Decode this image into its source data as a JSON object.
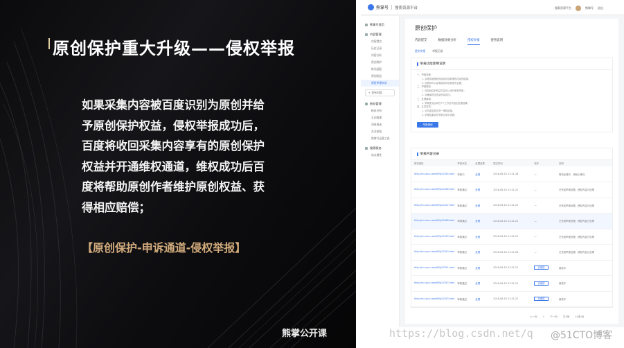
{
  "slide": {
    "title": "原创保护重大升级——侵权举报",
    "body": "如果采集内容被百度识别为原创并给予原创保护权益，侵权举报成功后，百度将收回采集内容享有的原创保护权益并开通维权通道，维权成功后百度将帮助原创作者维护原创权益、获得相应赔偿；",
    "highlight": "【原创保护-申诉通道-侵权举报】",
    "logo": "熊掌公开课"
  },
  "screenshot": {
    "brand": "熊掌号",
    "brand_sub": "搜索资源平台",
    "top_links": [
      "搜索资源平台",
      "熊掌号",
      "退出"
    ],
    "sidebar": [
      {
        "head": "熊掌号首页",
        "items": []
      },
      {
        "head": "内容管理",
        "items": [
          "内容提交",
          "历史记录",
          "内容分析",
          "原创保护",
          "移动适配",
          "原创权益",
          "侵权举报申诉"
        ]
      },
      {
        "head": "",
        "button": "+ 发布内容",
        "items": []
      },
      {
        "head": "粉丝管理",
        "items": [
          "粉丝分析",
          "互动管理",
          "消息推送",
          "关注按钮",
          "熊掌号运营工具"
        ]
      },
      {
        "head": "搜索服务",
        "items": [
          "站点属性"
        ]
      }
    ],
    "active_sidebar_item": "侵权举报申诉",
    "page_title": "原创保护",
    "tabs": [
      "内容提交",
      "数据效果分析",
      "侵权举报",
      "使用说明"
    ],
    "active_tab": "侵权举报",
    "subtabs": [
      "提交举报",
      "举报记录"
    ],
    "notice_title": "举报功能使用说明",
    "notice_lines": [
      "一、举报流程：",
      "1. 请提供被侵权的原创内容和侵权内容的链接；",
      "2. 请提供可以证明原创内容首发的证据；",
      "二、举报规则：",
      "1. 仅原创保护权益内容可以进行侵权举报；",
      "2. 请确保提交信息的真实性；",
      "三、处理周期：",
      "1. 举报提交后将在7个工作日内给出处理结果；",
      "四、注意事项：",
      "1. 请勿重复提交同一侵权链接；",
      "2. 处理结果请在举报记录中查看；"
    ],
    "report_button": "举报侵权",
    "records_title": "举报内容记录",
    "table_headers": [
      "侵权链接",
      "举报状态",
      "处理结果",
      "提交时间",
      "操作",
      "说明"
    ],
    "table_rows": [
      {
        "link": "http://m.xxxx.com/ffl/g12345.html",
        "status": "审核中",
        "result": "处理",
        "time": "2018-06-15 21:21:18",
        "op": "—",
        "note": "等待处理中，请耐心等待"
      },
      {
        "link": "http://m.xxxx.com/ffl/g12346.html",
        "status": "审核通过",
        "result": "处理",
        "time": "2018-06-15 21:21:21",
        "op": "—",
        "note": "已完成举报处理，侵权内容已处理"
      },
      {
        "link": "http://m.xxxx.com/ffl/g12347.html",
        "status": "审核通过",
        "result": "处理",
        "time": "2018-06-15 21:21:21",
        "op": "—",
        "note": "已完成举报处理，侵权内容已处理"
      },
      {
        "link": "http://m.xxxx.com/ffl/g12348.html",
        "status": "审核通过",
        "result": "处理",
        "time": "2018-06-15 21:21:21",
        "op": "—",
        "note": "已完成举报处理，侵权内容已处理"
      },
      {
        "link": "http://m.xxxx.com/ffl/g12349.html",
        "status": "审核通过",
        "result": "处理",
        "time": "2018-06-15 21:21:21",
        "op": "—",
        "note": "已完成举报处理，侵权内容已处理"
      },
      {
        "link": "http://m.xxxx.com/ffl/g12350.html",
        "status": "审核通过",
        "result": "处理",
        "time": "2018-06-15 21:21:26",
        "op": "—",
        "note": "已完成举报处理，侵权内容已处理"
      },
      {
        "link": "http://m.xxxx.com/ffl/g12351.html",
        "status": "审核通过",
        "result": "处理",
        "time": "2018-06-15 21:21:21",
        "op": "去维权",
        "note": "维权中"
      },
      {
        "link": "http://m.xxxx.com/ffl/g12352.html",
        "status": "审核通过",
        "result": "处理",
        "time": "2018-06-15 21:21:21",
        "op": "去维权",
        "note": "维权中"
      },
      {
        "link": "http://m.xxxx.com/ffl/g12353.html",
        "status": "审核通过",
        "result": "处理",
        "time": "2018-06-15 21:21:21",
        "op": "去维权",
        "note": "维权中"
      }
    ],
    "pager": [
      "上一页",
      "1",
      "下一页",
      "共9条",
      "10条/页"
    ]
  },
  "watermark": {
    "url": "https://blog.csdn.net/q",
    "brand": "@51CTO博客"
  },
  "colors": {
    "accent": "#3a77e8",
    "highlight_gold": "#d2ab7c",
    "slide_bg": "#0d0d10"
  }
}
